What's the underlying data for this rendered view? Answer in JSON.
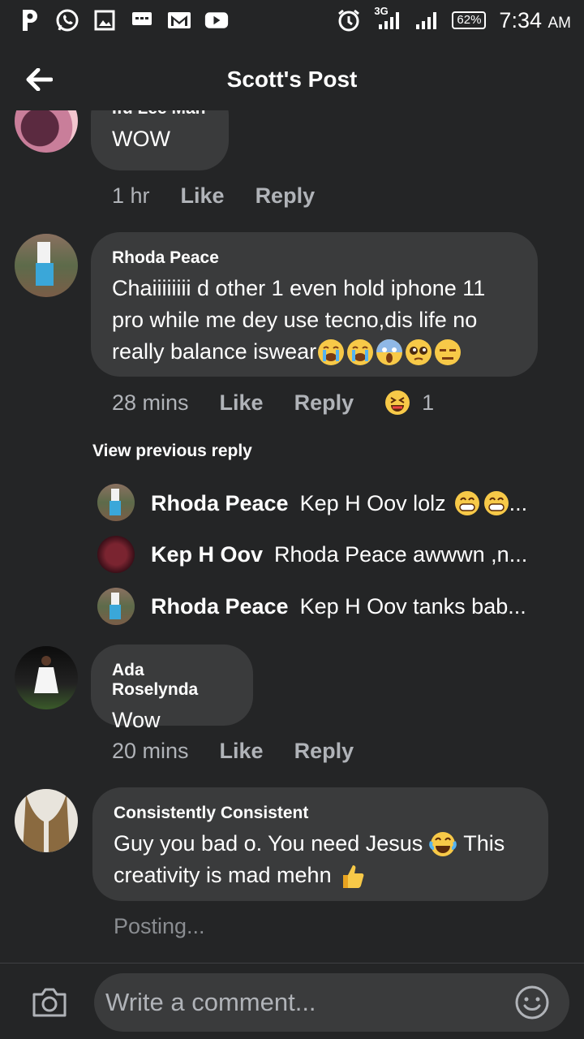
{
  "status_bar": {
    "network": "3G",
    "battery": "62%",
    "time": "7:34",
    "ampm": "AM"
  },
  "header": {
    "title": "Scott's Post"
  },
  "comments": [
    {
      "author": "Ifu Lee Man",
      "text": "WOW",
      "time": "1 hr",
      "like": "Like",
      "reply": "Reply"
    },
    {
      "author": "Rhoda Peace",
      "text_lines": [
        "Chaiiiiiiii d other  1 even hold iphone 11",
        "pro while me dey use tecno,dis life no",
        "really balance iswear"
      ],
      "time": "28 mins",
      "like": "Like",
      "reply": "Reply",
      "reaction_count": "1"
    },
    {
      "author": "Ada Roselynda",
      "text": "Wow",
      "time": "20 mins",
      "like": "Like",
      "reply": "Reply"
    },
    {
      "author": "Consistently Consistent",
      "text_line1": "Guy you bad o. You need Jesus",
      "text_line1_end": "This",
      "text_line2": "creativity is mad mehn",
      "posting": "Posting..."
    }
  ],
  "view_previous": "View previous reply",
  "replies": [
    {
      "name": "Rhoda Peace",
      "text": "Kep H Oov lolz",
      "suffix": "..."
    },
    {
      "name": "Kep H Oov",
      "text": "Rhoda Peace awwwn ,n..."
    },
    {
      "name": "Rhoda Peace",
      "text": "Kep H Oov tanks bab..."
    }
  ],
  "composer": {
    "placeholder": "Write a comment..."
  },
  "colors": {
    "background": "#242526",
    "bubble": "#3a3b3c",
    "muted_text": "#b0b3b8"
  }
}
